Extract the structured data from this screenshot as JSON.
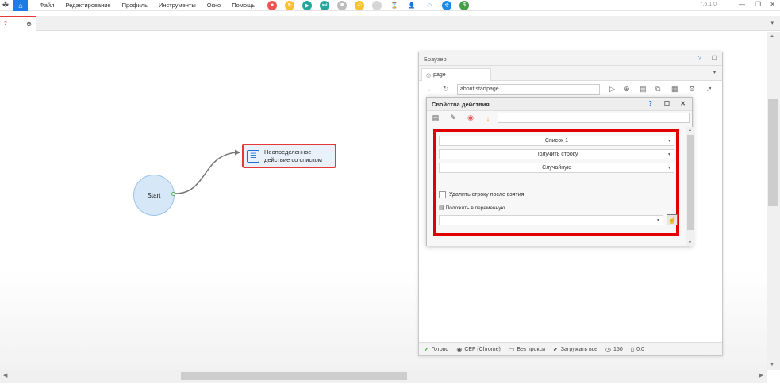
{
  "menu": {
    "items": [
      "Файл",
      "Редактирование",
      "Профиль",
      "Инструменты",
      "Окно",
      "Помощь"
    ],
    "version": "7.5.1.0"
  },
  "toolbar": {
    "buttons": [
      {
        "icon": "record-icon",
        "color": "#ef5350"
      },
      {
        "icon": "refresh-icon",
        "color": "#fbc02d"
      },
      {
        "icon": "play-icon",
        "color": "#26a69a"
      },
      {
        "icon": "step-icon",
        "color": "#26a69a"
      },
      {
        "icon": "stop-icon",
        "color": "#bdbdbd"
      },
      {
        "icon": "undo-icon",
        "color": "#fbc02d"
      },
      {
        "icon": "pause-icon",
        "color": "#bdbdbd"
      },
      {
        "icon": "timer-icon",
        "color": "#f9a825"
      },
      {
        "icon": "user-icon",
        "color": "#1e88e5"
      },
      {
        "icon": "wifi-icon",
        "color": "#90caf9"
      },
      {
        "icon": "network-icon",
        "color": "#1e88e5"
      },
      {
        "icon": "dollar-icon",
        "color": "#43a047"
      }
    ]
  },
  "doc_tab": {
    "number": "2",
    "close": "⊗"
  },
  "canvas": {
    "start_node": {
      "label": "Start"
    },
    "action_node": {
      "line1": "Неопределенное",
      "line2": "действие со списком"
    }
  },
  "browser": {
    "title": "Браузер",
    "help": "?",
    "tab_label": "page",
    "url": "about:startpage",
    "status": {
      "ready": "Готово",
      "engine": "CEF (Chrome)",
      "proxy": "Без прокси",
      "load": "Загружать все",
      "timeout": "150",
      "coords": "0;0"
    }
  },
  "props": {
    "title": "Свойства действия",
    "help": "?",
    "list_select": "Список 1",
    "operation_select": "Получить строку",
    "mode_select": "Случайную",
    "delete_checkbox_label": "Удалить строку после взятия",
    "delete_checked": false,
    "variable_label": "Положить в переменную",
    "variable_value": ""
  }
}
